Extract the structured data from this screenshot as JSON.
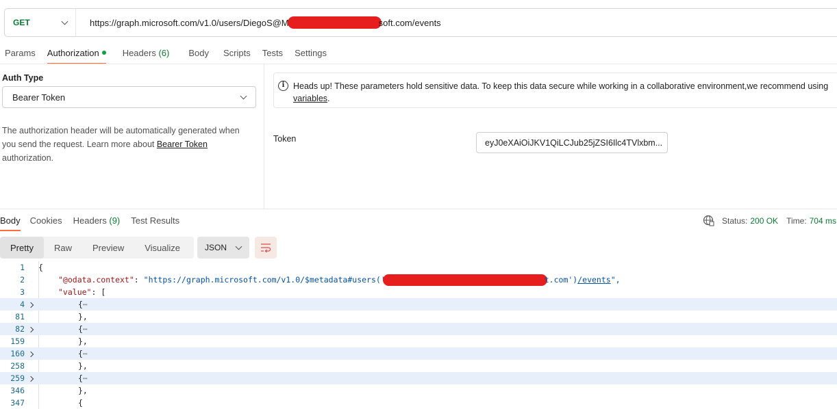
{
  "request": {
    "method": "GET",
    "url_prefix": "https://graph.microsoft.com/v1.0/users/DiegoS@M",
    "url_suffix": "soft.com/events"
  },
  "request_tabs": [
    {
      "label": "Params"
    },
    {
      "label": "Authorization"
    },
    {
      "label": "Headers",
      "count": "(6)"
    },
    {
      "label": "Body"
    },
    {
      "label": "Scripts"
    },
    {
      "label": "Tests"
    },
    {
      "label": "Settings"
    }
  ],
  "auth": {
    "type_label": "Auth Type",
    "type_value": "Bearer Token",
    "desc_before": "The authorization header will be automatically generated when you send the request. Learn more about ",
    "desc_link": "Bearer Token",
    "desc_after": " authorization.",
    "notice_text": "Heads up! These parameters hold sensitive data. To keep this data secure while working in a collaborative environment,we recommend using",
    "notice_link": "variables",
    "notice_end": ".",
    "token_label": "Token",
    "token_value": "eyJ0eXAiOiJKV1QiLCJub25jZSI6Ilc4TVlxbm..."
  },
  "response_tabs": [
    {
      "label": "Body"
    },
    {
      "label": "Cookies"
    },
    {
      "label": "Headers",
      "count": "(9)"
    },
    {
      "label": "Test Results"
    }
  ],
  "status": {
    "status_label": "Status:",
    "status_value": "200 OK",
    "time_label": "Time:",
    "time_value": "704 ms"
  },
  "view_tabs": [
    "Pretty",
    "Raw",
    "Preview",
    "Visualize"
  ],
  "format": "JSON",
  "code": {
    "line2_key": "\"@odata.context\"",
    "line2_str_prefix": "\"https://graph.microsoft.com/v1.0/$metadata#users('",
    "line2_str_mid": "t.com')",
    "line2_link": "/events",
    "line2_end": "\",",
    "line3_key": "\"value\"",
    "lines": [
      "1",
      "2",
      "3",
      "4",
      "81",
      "82",
      "159",
      "160",
      "258",
      "259",
      "346",
      "347"
    ]
  }
}
